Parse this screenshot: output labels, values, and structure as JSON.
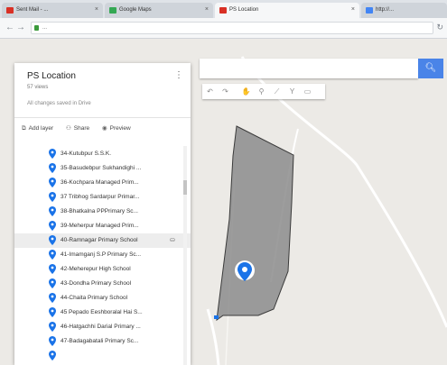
{
  "browser": {
    "tabs": [
      {
        "label": "Sent Mail - ...",
        "favicon_color": "#d93025"
      },
      {
        "label": "Google Maps",
        "favicon_color": "#34a853"
      },
      {
        "label": "PS Location",
        "favicon_color": "#d93025"
      },
      {
        "label": "http://...",
        "favicon_color": "#4285f4"
      }
    ],
    "active_tab": 2,
    "url": "..."
  },
  "panel": {
    "title": "PS Location",
    "views": "57 views",
    "saved_status": "All changes saved in Drive",
    "actions": {
      "add_layer": "Add layer",
      "share": "Share",
      "preview": "Preview"
    },
    "items": [
      "34-Kutubpur S.S.K.",
      "35-Basudebpur Sukhandighi ...",
      "36-Kochpara Managed Prim...",
      "37 Tribhog Sardarpur Primar...",
      "38-Bhatkalna PPPrimary Sc...",
      "39-Meherpur Managed Prim...",
      "40-Ramnagar Primary School",
      "41-Imamganj S.P Primary Sc...",
      "42-Meherepur High School",
      "43-Dondha Primary School",
      "44-Chaita Primary School",
      "45 Pepado Eeshboralal Hai S...",
      "46-Hatgachhi Darial Primary ...",
      "47-Badagabatali Primary Sc..."
    ],
    "selected_index": 6
  },
  "map": {
    "search_placeholder": "",
    "pin_color": "#1a73e8",
    "polygon_color": "#8c8c8c"
  },
  "icons": {
    "search": "search-icon",
    "undo": "undo-icon",
    "redo": "redo-icon",
    "hand": "hand-icon",
    "marker": "marker-icon",
    "line": "draw-line-icon",
    "route": "route-icon",
    "ruler": "ruler-icon",
    "menu": "more-vert-icon"
  }
}
